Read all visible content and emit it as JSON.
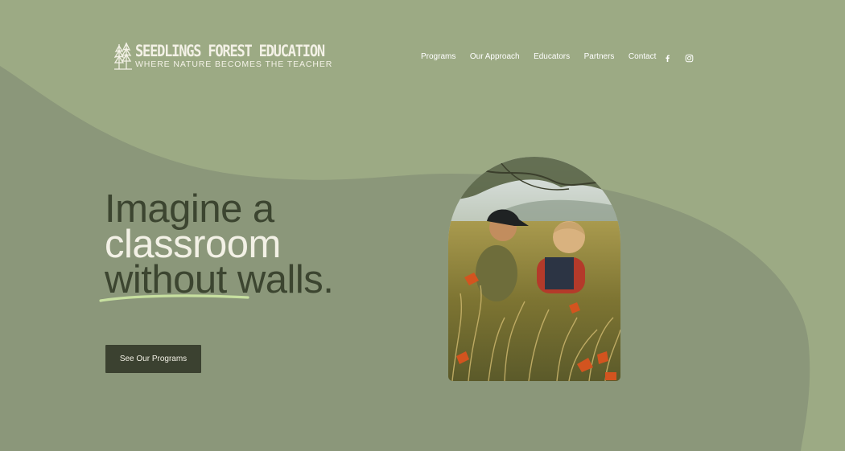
{
  "brand": {
    "name": "SEEDLINGS FOREST EDUCATION",
    "tagline": "WHERE NATURE BECOMES THE TEACHER",
    "logo_icon": "trees-icon"
  },
  "nav": {
    "items": [
      {
        "label": "Programs"
      },
      {
        "label": "Our Approach"
      },
      {
        "label": "Educators"
      },
      {
        "label": "Partners"
      },
      {
        "label": "Contact"
      }
    ]
  },
  "social": {
    "facebook_icon": "facebook-icon",
    "instagram_icon": "instagram-icon"
  },
  "hero": {
    "line1": "Imagine a",
    "line2": "classroom",
    "line3_a": "without",
    "line3_b": " walls.",
    "cta_label": "See Our Programs",
    "photo": "children-in-tall-grass-photo"
  },
  "colors": {
    "background": "#9caa84",
    "wave": "#8b977a",
    "headline_dark": "#3c4530",
    "headline_light": "#f3f1e6",
    "underline": "#c7e0a0",
    "cta_bg": "#3b4130"
  }
}
